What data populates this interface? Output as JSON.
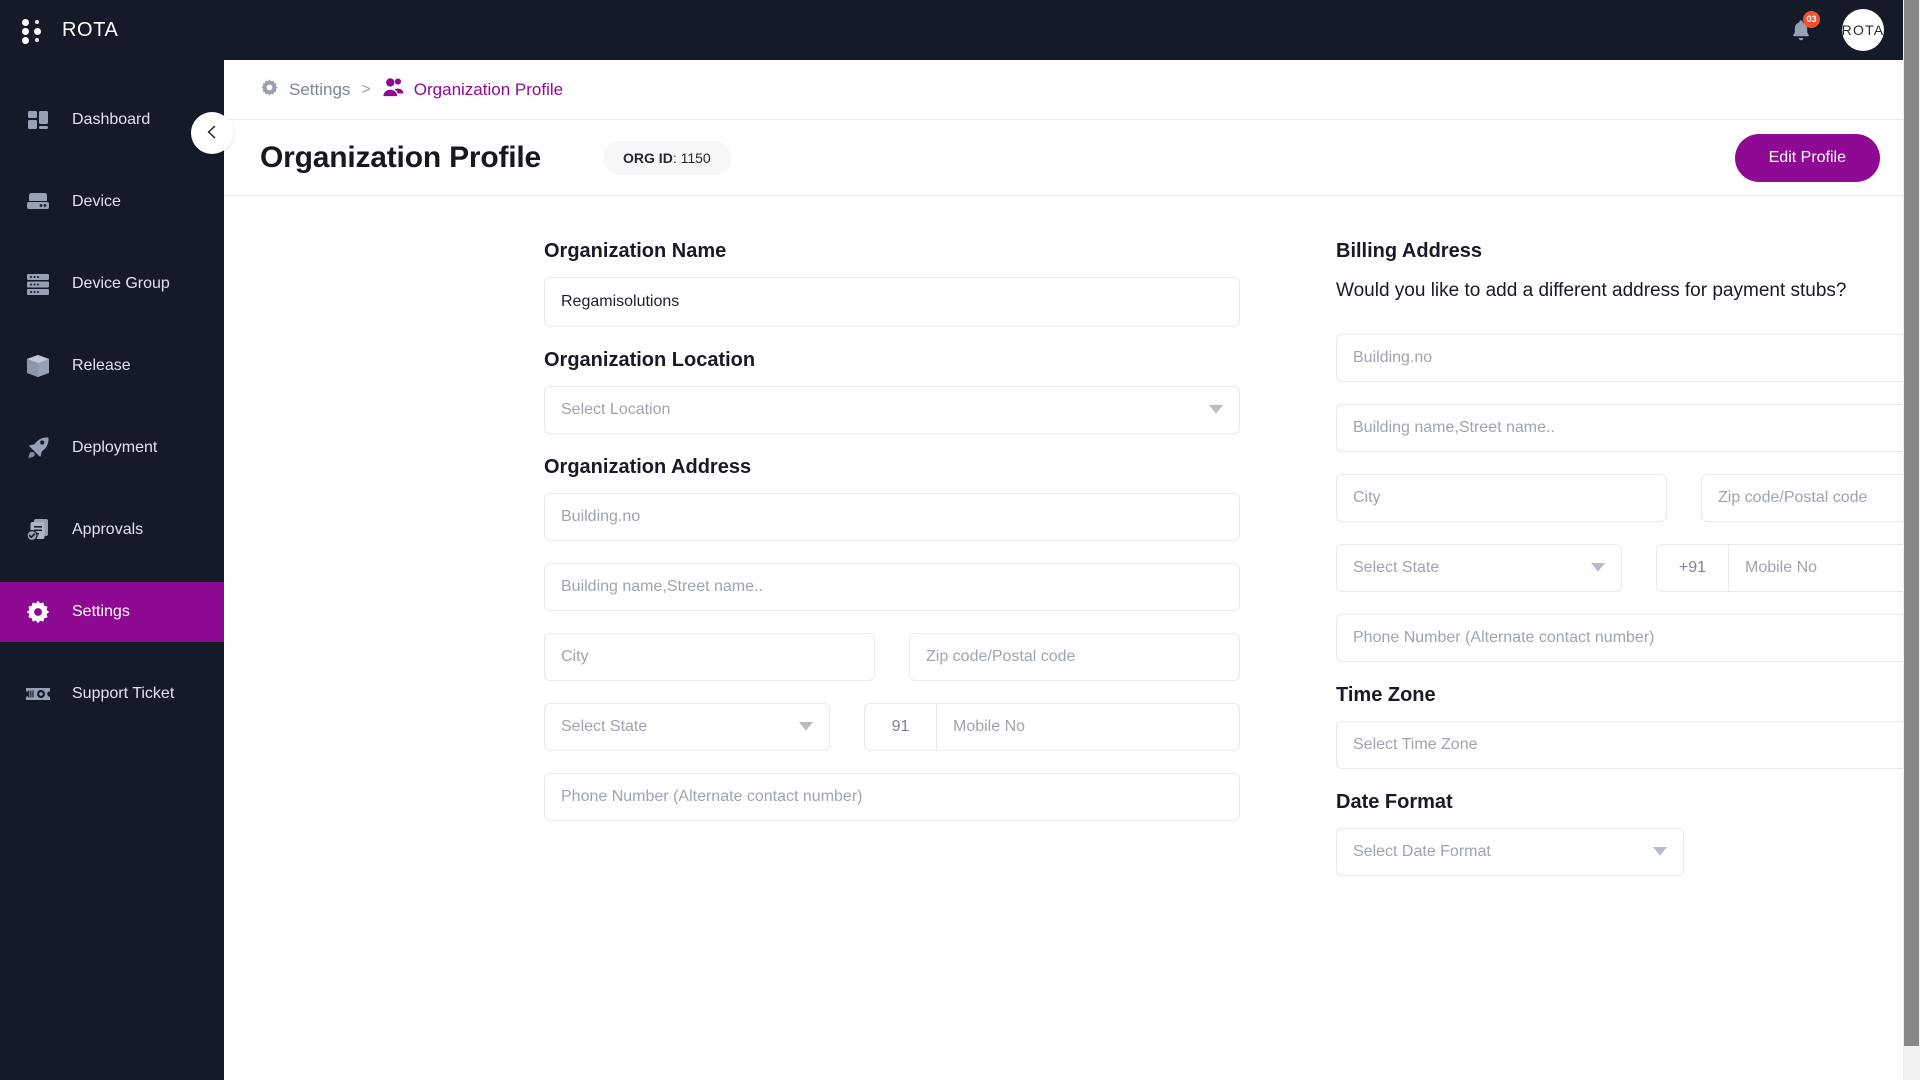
{
  "topbar": {
    "brand": "ROTA",
    "notification_count": "03",
    "avatar_text": "ROTA",
    "accent": "#8f0a92",
    "bar_bg": "#141a28",
    "badge_color": "#f4502a"
  },
  "sidebar": {
    "items": [
      {
        "label": "Dashboard",
        "icon": "dashboard-icon",
        "active": false
      },
      {
        "label": "Device",
        "icon": "device-icon",
        "active": false
      },
      {
        "label": "Device Group",
        "icon": "device-group-icon",
        "active": false
      },
      {
        "label": "Release",
        "icon": "release-box-icon",
        "active": false
      },
      {
        "label": "Deployment",
        "icon": "rocket-icon",
        "active": false
      },
      {
        "label": "Approvals",
        "icon": "approvals-icon",
        "active": false
      },
      {
        "label": "Settings",
        "icon": "gear-icon",
        "active": true
      },
      {
        "label": "Support Ticket",
        "icon": "ticket-icon",
        "active": false
      }
    ]
  },
  "breadcrumb": {
    "parent": "Settings",
    "separator": ">",
    "current": "Organization Profile"
  },
  "page": {
    "title": "Organization Profile",
    "org_id_label": "ORG ID",
    "org_id_value": "1150",
    "edit_button": "Edit Profile"
  },
  "left_form": {
    "org_name_label": "Organization Name",
    "org_name_value": "Regamisolutions",
    "org_location_label": "Organization Location",
    "org_location_placeholder": "Select Location",
    "org_address_label": "Organization Address",
    "building_no_placeholder": "Building.no",
    "street_placeholder": "Building name,Street name..",
    "city_placeholder": "City",
    "zip_placeholder": "Zip code/Postal code",
    "state_placeholder": "Select State",
    "country_code": "91",
    "mobile_placeholder": "Mobile No",
    "alt_phone_placeholder": "Phone Number (Alternate contact number)"
  },
  "right_form": {
    "billing_label": "Billing Address",
    "billing_question": "Would you like to add a different address for payment stubs?",
    "toggle_state": "off",
    "building_no_placeholder": "Building.no",
    "street_placeholder": "Building name,Street name..",
    "city_placeholder": "City",
    "zip_placeholder": "Zip code/Postal code",
    "state_placeholder": "Select State",
    "country_code": "+91",
    "mobile_placeholder": "Mobile No",
    "alt_phone_placeholder": "Phone Number (Alternate contact number)",
    "timezone_label": "Time Zone",
    "timezone_placeholder": "Select Time Zone",
    "dateformat_label": "Date Format",
    "dateformat_placeholder": "Select Date Format"
  }
}
